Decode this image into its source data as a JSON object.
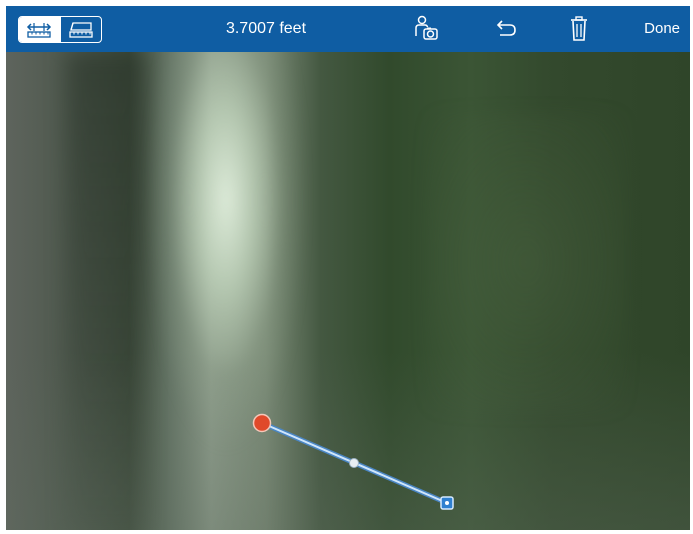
{
  "toolbar": {
    "measurement_value": "3.7007 feet",
    "done_label": "Done",
    "modes": [
      {
        "name": "ruler-mode",
        "active": true,
        "icon": "ruler-icon"
      },
      {
        "name": "plane-ruler-mode",
        "active": false,
        "icon": "plane-ruler-icon"
      }
    ],
    "tools": [
      {
        "name": "camera-person",
        "icon": "person-camera-icon"
      },
      {
        "name": "undo",
        "icon": "undo-icon"
      },
      {
        "name": "delete",
        "icon": "trash-icon"
      }
    ]
  },
  "colors": {
    "toolbar_bg": "#0f5da3",
    "line": "#a8cff5",
    "start_point": "#e0492a",
    "end_point": "#2f80d0"
  }
}
